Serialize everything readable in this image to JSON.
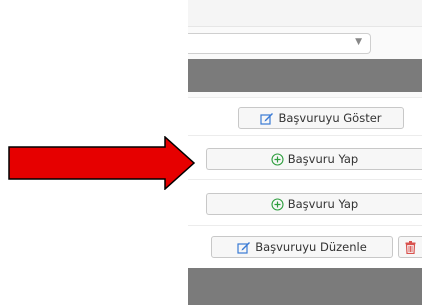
{
  "select": {
    "value": ""
  },
  "rows": [
    {
      "button": {
        "label": "Başvuruyu Göster",
        "icon": "edit-icon",
        "color": "#3a7bd5"
      }
    },
    {
      "button": {
        "label": "Başvuru Yap",
        "icon": "plus-circle-icon",
        "color": "#2e9e3e"
      }
    },
    {
      "button": {
        "label": "Başvuru Yap",
        "icon": "plus-circle-icon",
        "color": "#2e9e3e"
      }
    },
    {
      "button": {
        "label": "Başvuruyu Düzenle",
        "icon": "edit-icon",
        "color": "#3a7bd5"
      },
      "delete": {
        "icon": "trash-icon",
        "color": "#d9534f"
      }
    }
  ],
  "annotation": {
    "icon": "red-arrow-icon",
    "color": "#e60000"
  }
}
